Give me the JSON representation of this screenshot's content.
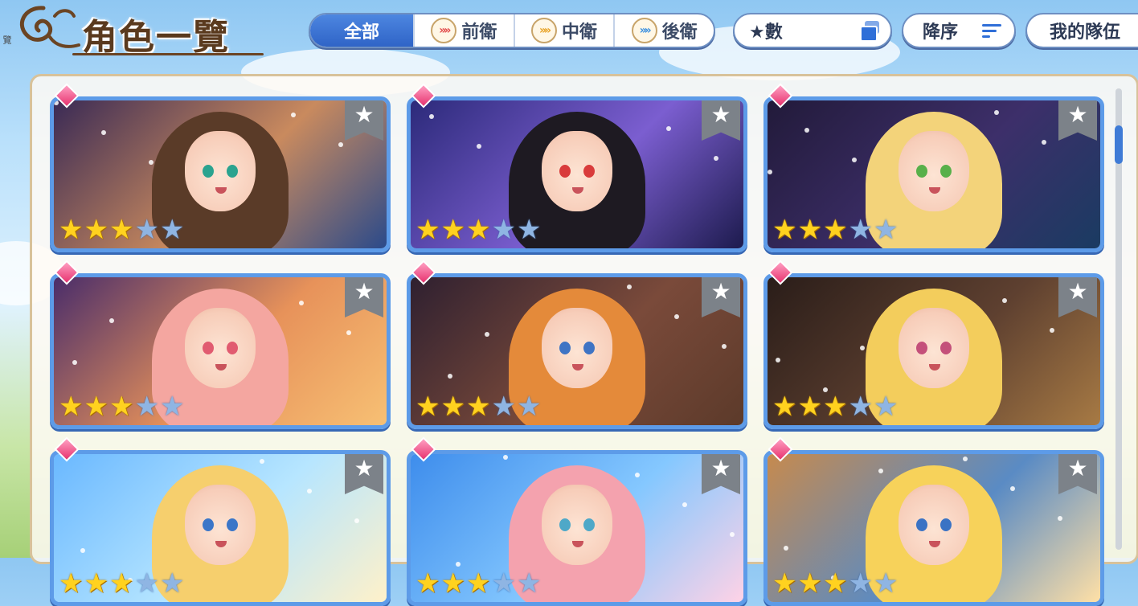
{
  "header": {
    "title": "角色一覽"
  },
  "tabs": [
    {
      "label": "全部",
      "icon": "",
      "active": true
    },
    {
      "label": "前衛",
      "icon": "front-position-icon",
      "glyph": "»»",
      "active": false
    },
    {
      "label": "中衛",
      "icon": "middle-position-icon",
      "glyph": "»»",
      "active": false
    },
    {
      "label": "後衛",
      "icon": "back-position-icon",
      "glyph": "»»",
      "active": false
    }
  ],
  "filters": {
    "star_sort_label": "★數",
    "order_label": "降序",
    "team_label": "我的隊伍"
  },
  "side_fragment": "覽",
  "colors": {
    "accent": "#2f64c7",
    "card_border": "#5d9be8",
    "star_on": "#ffd21f",
    "star_off": "#8fb5e3",
    "gem": "#e7336f"
  },
  "cards": [
    {
      "name": "card-1",
      "rarity": 3,
      "max": 5,
      "theme": "dark-magic",
      "bg": [
        "#3a2a55",
        "#c98a5e",
        "#2b4a8a"
      ],
      "hair": "#5a3b28",
      "eye": "#2aa38f"
    },
    {
      "name": "card-2",
      "rarity": 3,
      "max": 5,
      "theme": "christmas-night",
      "bg": [
        "#2c2a7a",
        "#7b5ed0",
        "#1d1b4e"
      ],
      "hair": "#1e1a22",
      "eye": "#d93b3b"
    },
    {
      "name": "card-3",
      "rarity": 3,
      "max": 5,
      "theme": "halloween-night",
      "bg": [
        "#221a3a",
        "#3d2f6a",
        "#1a3b62"
      ],
      "hair": "#f3d37a",
      "eye": "#58b04a"
    },
    {
      "name": "card-4",
      "rarity": 3,
      "max": 5,
      "theme": "halloween-festival",
      "bg": [
        "#4a2d6a",
        "#e7925a",
        "#f7c074"
      ],
      "hair": "#f4a6a0",
      "eye": "#e15b70"
    },
    {
      "name": "card-5",
      "rarity": 3,
      "max": 5,
      "theme": "library",
      "bg": [
        "#2f2030",
        "#7a4a3a",
        "#5c3a2a"
      ],
      "hair": "#e48a3a",
      "eye": "#3f74c4"
    },
    {
      "name": "card-6",
      "rarity": 3,
      "max": 5,
      "theme": "study-room",
      "bg": [
        "#2a1d19",
        "#5e4030",
        "#a77a44"
      ],
      "hair": "#f3cd5c",
      "eye": "#c4507a"
    },
    {
      "name": "card-7",
      "rarity": 3,
      "max": 5,
      "theme": "summer-sky",
      "bg": [
        "#6ab8ff",
        "#b7e6ff",
        "#fff1c9"
      ],
      "hair": "#f6cf6d",
      "eye": "#3b76c8"
    },
    {
      "name": "card-8",
      "rarity": 3,
      "max": 5,
      "theme": "rainbow-beach",
      "bg": [
        "#3e8dec",
        "#85c8ff",
        "#ffd2e6"
      ],
      "hair": "#f4a2ae",
      "eye": "#4ea8c8"
    },
    {
      "name": "card-9",
      "rarity": 3,
      "max": 5,
      "theme": "festival-arena",
      "bg": [
        "#c68a4e",
        "#5a8bc4",
        "#ffe0a6"
      ],
      "hair": "#f7d25a",
      "eye": "#3b73c4"
    }
  ]
}
